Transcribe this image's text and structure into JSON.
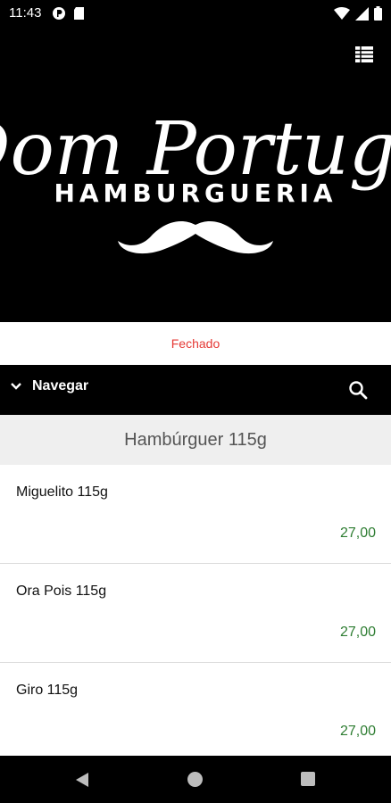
{
  "status_bar": {
    "time": "11:43"
  },
  "brand": {
    "script_name": "Dom Portuga",
    "subtitle": "HAMBURGUERIA"
  },
  "store_status": {
    "label": "Fechado"
  },
  "nav": {
    "label": "Navegar"
  },
  "category": {
    "title": "Hambúrguer 115g"
  },
  "products": [
    {
      "name": "Miguelito 115g",
      "price": "27,00"
    },
    {
      "name": "Ora Pois 115g",
      "price": "27,00"
    },
    {
      "name": "Giro 115g",
      "price": "27,00"
    }
  ],
  "colors": {
    "status_closed": "#e53935",
    "price": "#2e7d32",
    "header_bg": "#000000",
    "category_bg": "#efefef"
  },
  "icons": [
    "grid-menu-icon",
    "chevron-down-icon",
    "search-icon",
    "back-icon",
    "home-icon",
    "recents-icon",
    "mustache-logo"
  ]
}
